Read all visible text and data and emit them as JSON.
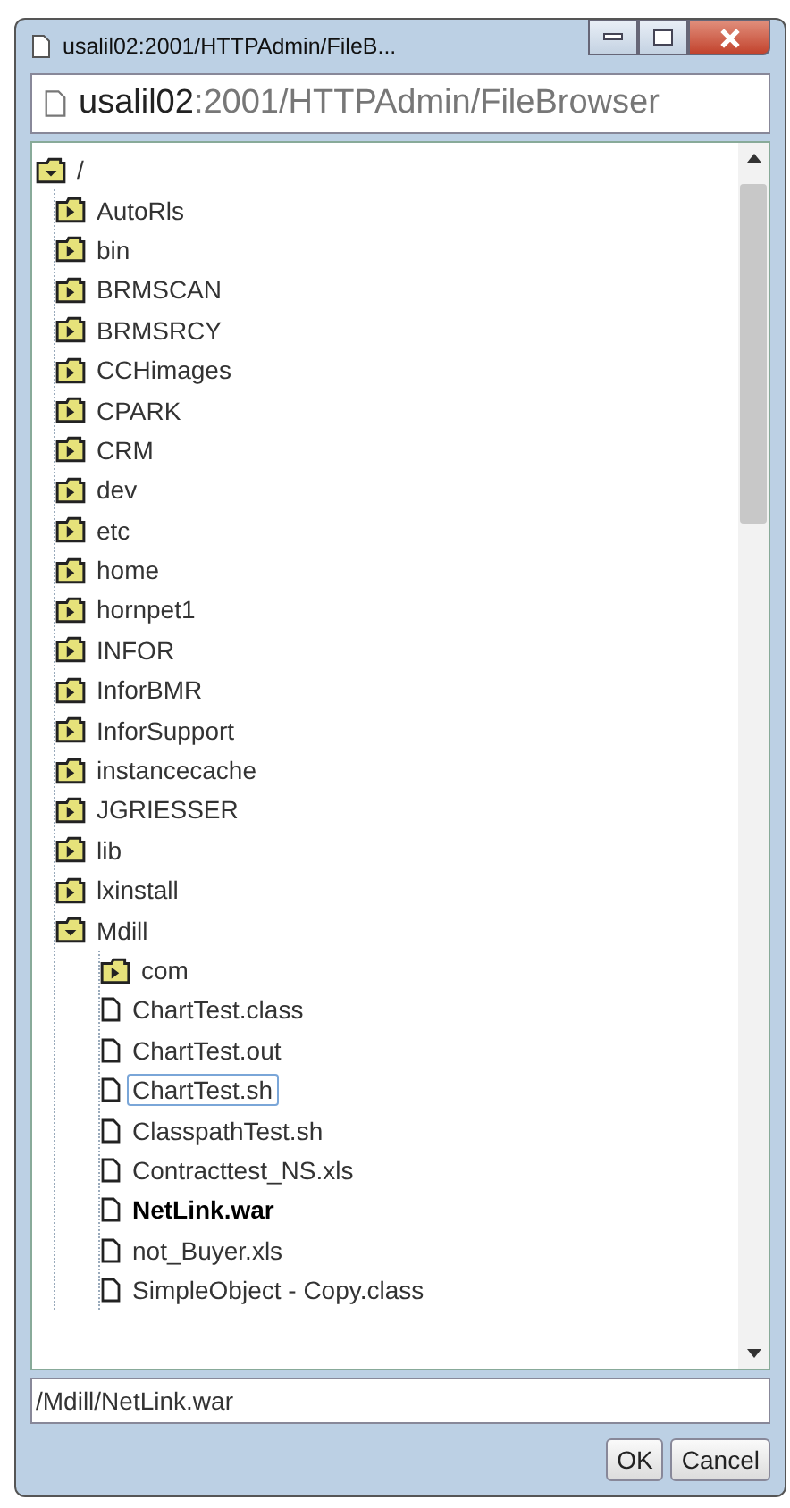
{
  "window": {
    "title": "usalil02:2001/HTTPAdmin/FileB..."
  },
  "address": {
    "host": "usalil02",
    "rest": ":2001/HTTPAdmin/FileBrowser"
  },
  "tree": [
    {
      "kind": "folder",
      "label": "/",
      "expanded": true,
      "selected": false,
      "focused": false,
      "children": [
        {
          "kind": "folder",
          "label": "AutoRls",
          "expanded": false,
          "selected": false,
          "focused": false
        },
        {
          "kind": "folder",
          "label": "bin",
          "expanded": false,
          "selected": false,
          "focused": false
        },
        {
          "kind": "folder",
          "label": "BRMSCAN",
          "expanded": false,
          "selected": false,
          "focused": false
        },
        {
          "kind": "folder",
          "label": "BRMSRCY",
          "expanded": false,
          "selected": false,
          "focused": false
        },
        {
          "kind": "folder",
          "label": "CCHimages",
          "expanded": false,
          "selected": false,
          "focused": false
        },
        {
          "kind": "folder",
          "label": "CPARK",
          "expanded": false,
          "selected": false,
          "focused": false
        },
        {
          "kind": "folder",
          "label": "CRM",
          "expanded": false,
          "selected": false,
          "focused": false
        },
        {
          "kind": "folder",
          "label": "dev",
          "expanded": false,
          "selected": false,
          "focused": false
        },
        {
          "kind": "folder",
          "label": "etc",
          "expanded": false,
          "selected": false,
          "focused": false
        },
        {
          "kind": "folder",
          "label": "home",
          "expanded": false,
          "selected": false,
          "focused": false
        },
        {
          "kind": "folder",
          "label": "hornpet1",
          "expanded": false,
          "selected": false,
          "focused": false
        },
        {
          "kind": "folder",
          "label": "INFOR",
          "expanded": false,
          "selected": false,
          "focused": false
        },
        {
          "kind": "folder",
          "label": "InforBMR",
          "expanded": false,
          "selected": false,
          "focused": false
        },
        {
          "kind": "folder",
          "label": "InforSupport",
          "expanded": false,
          "selected": false,
          "focused": false
        },
        {
          "kind": "folder",
          "label": "instancecache",
          "expanded": false,
          "selected": false,
          "focused": false
        },
        {
          "kind": "folder",
          "label": "JGRIESSER",
          "expanded": false,
          "selected": false,
          "focused": false
        },
        {
          "kind": "folder",
          "label": "lib",
          "expanded": false,
          "selected": false,
          "focused": false
        },
        {
          "kind": "folder",
          "label": "lxinstall",
          "expanded": false,
          "selected": false,
          "focused": false
        },
        {
          "kind": "folder",
          "label": "Mdill",
          "expanded": true,
          "selected": false,
          "focused": false,
          "children": [
            {
              "kind": "folder",
              "label": "com",
              "expanded": false,
              "selected": false,
              "focused": false
            },
            {
              "kind": "file",
              "label": "ChartTest.class",
              "selected": false,
              "focused": false
            },
            {
              "kind": "file",
              "label": "ChartTest.out",
              "selected": false,
              "focused": false
            },
            {
              "kind": "file",
              "label": "ChartTest.sh",
              "selected": false,
              "focused": true
            },
            {
              "kind": "file",
              "label": "ClasspathTest.sh",
              "selected": false,
              "focused": false
            },
            {
              "kind": "file",
              "label": "Contracttest_NS.xls",
              "selected": false,
              "focused": false
            },
            {
              "kind": "file",
              "label": "NetLink.war",
              "selected": true,
              "focused": false
            },
            {
              "kind": "file",
              "label": "not_Buyer.xls",
              "selected": false,
              "focused": false
            },
            {
              "kind": "file",
              "label": "SimpleObject - Copy.class",
              "selected": false,
              "focused": false
            }
          ]
        }
      ]
    }
  ],
  "path_field": {
    "value": "/Mdill/NetLink.war"
  },
  "buttons": [
    {
      "label": "OK"
    },
    {
      "label": "Cancel"
    }
  ]
}
